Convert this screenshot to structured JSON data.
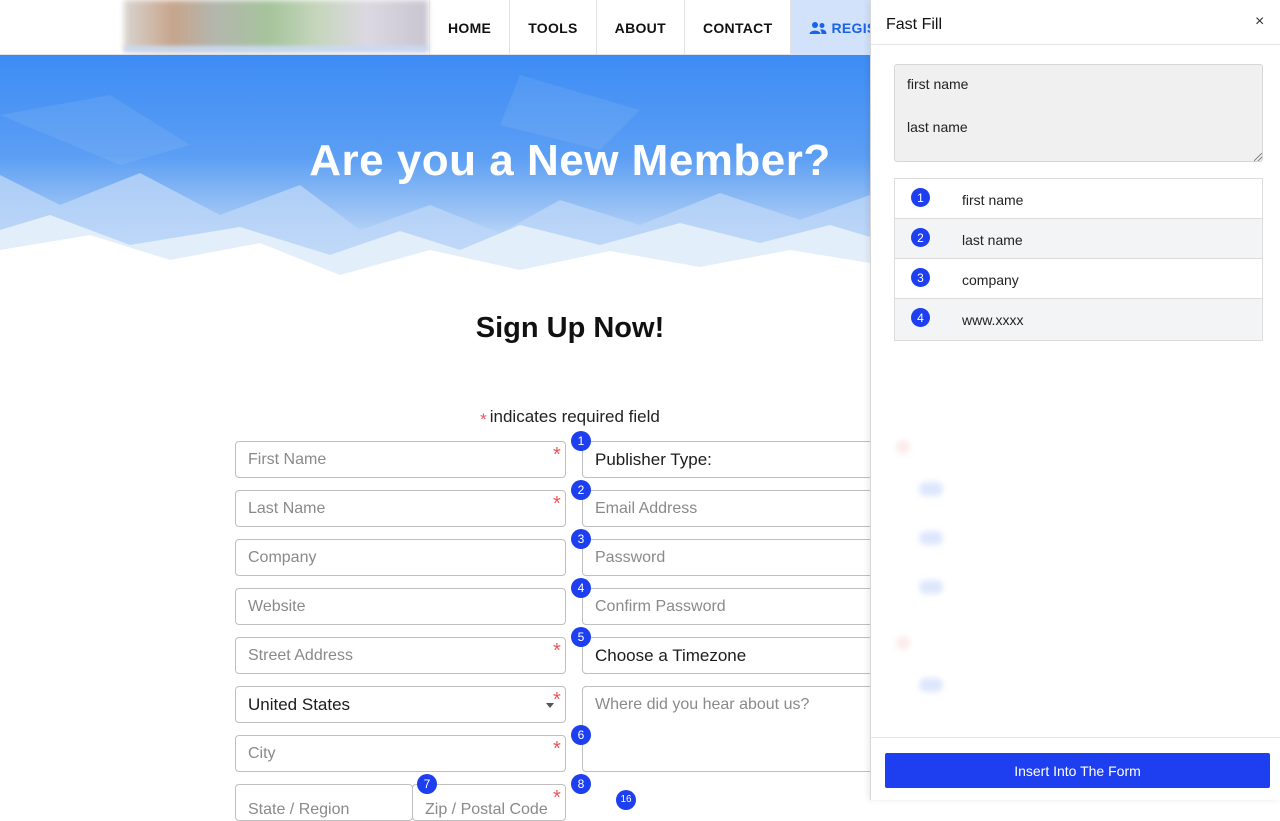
{
  "nav": {
    "items": [
      "HOME",
      "TOOLS",
      "ABOUT",
      "CONTACT"
    ],
    "register_label": "REGIST"
  },
  "hero": {
    "title": "Are you a New Member?"
  },
  "form": {
    "title": "Sign Up Now!",
    "required_note": "indicates required field",
    "required_mark": "*",
    "left_fields": [
      {
        "label": "First Name",
        "required": true
      },
      {
        "label": "Last Name",
        "required": true
      },
      {
        "label": "Company",
        "required": false
      },
      {
        "label": "Website",
        "required": false
      },
      {
        "label": "Street Address",
        "required": true
      },
      {
        "label": "United States",
        "required": true,
        "type": "select"
      },
      {
        "label": "City",
        "required": true
      }
    ],
    "bottom_fields": [
      "State / Region",
      "Zip / Postal Code"
    ],
    "right_fields": [
      {
        "label": "Publisher Type:",
        "type": "select"
      },
      {
        "label": "Email Address"
      },
      {
        "label": "Password"
      },
      {
        "label": "Confirm Password"
      },
      {
        "label": "Choose a Timezone",
        "type": "select"
      },
      {
        "label": "Where did you hear about us?",
        "type": "textarea"
      }
    ],
    "badges": [
      "1",
      "2",
      "3",
      "4",
      "5",
      "6",
      "7",
      "8",
      "16"
    ]
  },
  "panel": {
    "title": "Fast Fill",
    "close_glyph": "×",
    "textarea_value": "first name\n\nlast name",
    "rows": [
      {
        "num": "1",
        "label": "first name"
      },
      {
        "num": "2",
        "label": "last name"
      },
      {
        "num": "3",
        "label": "company"
      },
      {
        "num": "4",
        "label": "www.xxxx"
      }
    ],
    "insert_label": "Insert Into The Form"
  },
  "colors": {
    "accent": "#1d3ff0",
    "nav_active_bg": "#d2e2fb",
    "nav_active_text": "#1a63e8",
    "required": "#e8555b",
    "hero_top": "#3d8cf5"
  }
}
